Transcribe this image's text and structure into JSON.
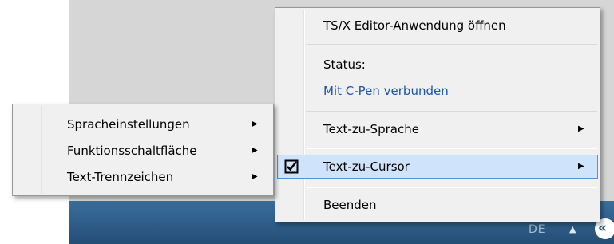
{
  "main_menu": {
    "items": [
      {
        "label": "TS/X Editor-Anwendung öffnen"
      },
      {
        "label": "Status:"
      },
      {
        "label": "Mit C-Pen verbunden"
      },
      {
        "label": "Text-zu-Sprache"
      },
      {
        "label": "Text-zu-Cursor"
      },
      {
        "label": "Beenden"
      }
    ]
  },
  "sub_menu": {
    "items": [
      {
        "label": "Spracheinstellungen"
      },
      {
        "label": "Funktionsschaltfläche"
      },
      {
        "label": "Text-Trennzeichen"
      }
    ]
  },
  "taskbar": {
    "language": "DE"
  },
  "icons": {
    "submenu_arrow": "▶",
    "checkbox": "checkbox-checked-icon",
    "tray_overflow": "chevron-up-icon",
    "tray_app": "c-pen-app-icon"
  },
  "colors": {
    "menu_background": "#f0f0f0",
    "status_text": "#1d55a6",
    "selected_background": "#cfe4fb",
    "selected_border": "#4f94dd",
    "taskbar": "#2b5b86"
  }
}
